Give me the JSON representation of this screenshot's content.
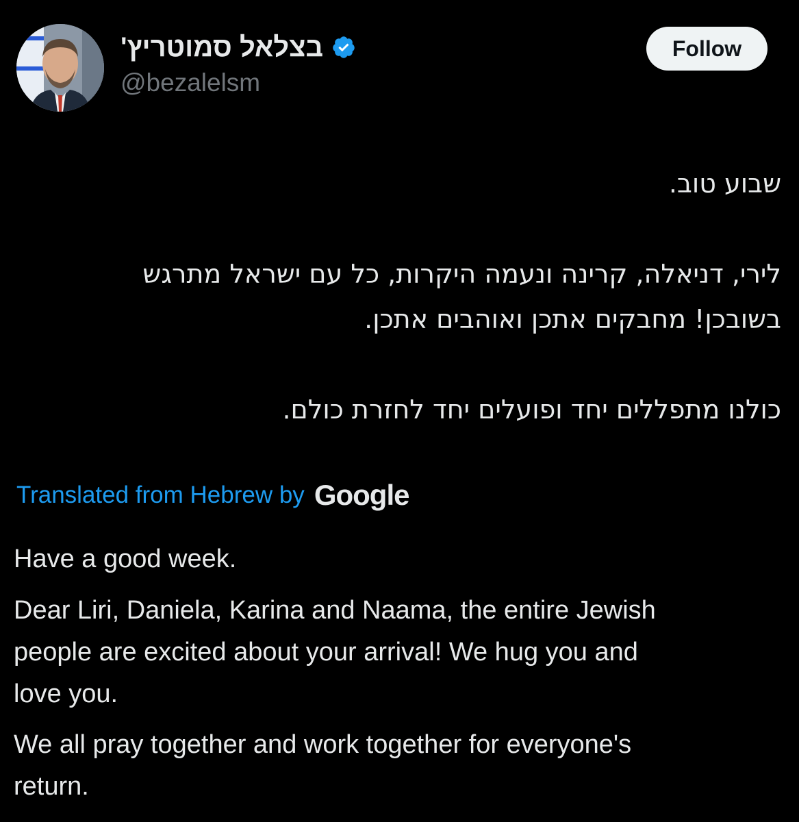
{
  "user": {
    "display_name": "בצלאל סמוטריץ'",
    "handle": "@bezalelsm",
    "verified_icon": "verified-badge-icon",
    "verified_color": "#1d9bf0"
  },
  "follow_button": {
    "label": "Follow"
  },
  "tweet": {
    "hebrew_lines": [
      "שבוע טוב.",
      "לירי, דניאלה, קרינה ונעמה היקרות, כל עם ישראל מתרגש",
      "בשובכן! מחבקים אתכן ואוהבים אתכן.",
      "כולנו מתפללים יחד ופועלים יחד לחזרת כולם."
    ],
    "translation": {
      "label": "Translated from Hebrew by",
      "provider": "Google",
      "label_color": "#1d9bf0"
    },
    "english_lines": [
      "Have a good week.",
      "Dear Liri, Daniela, Karina and Naama, the entire Jewish",
      "people are excited about your arrival! We hug you and",
      "love you.",
      "We all pray together and work together for everyone's",
      "return."
    ]
  }
}
